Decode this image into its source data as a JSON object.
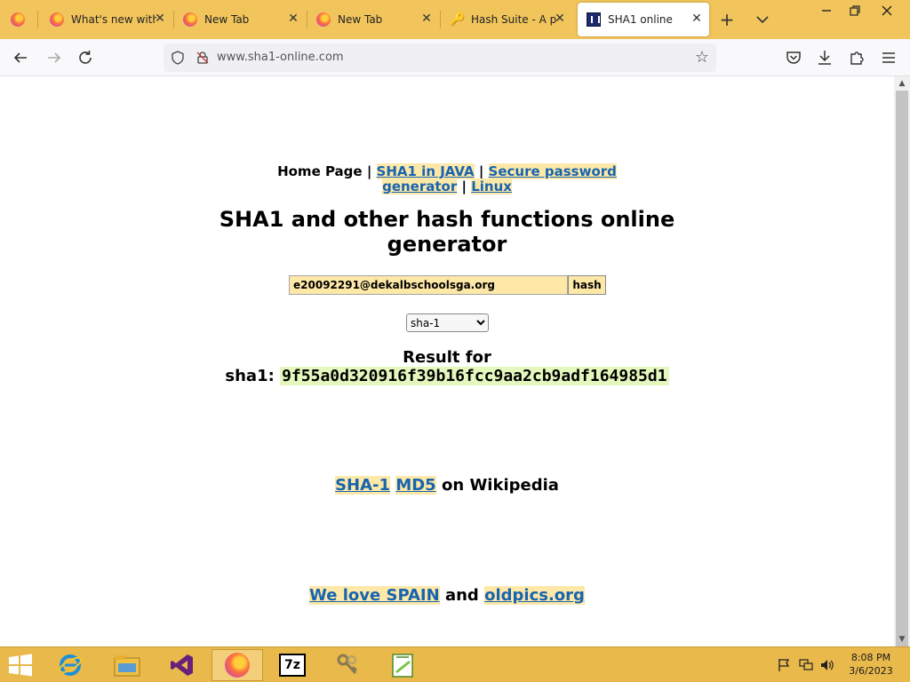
{
  "browser": {
    "tabs": [
      {
        "label": "What's new with F",
        "icon": "firefox-icon",
        "active": false
      },
      {
        "label": "New Tab",
        "icon": "firefox-icon",
        "active": false
      },
      {
        "label": "New Tab",
        "icon": "firefox-icon",
        "active": false
      },
      {
        "label": "Hash Suite - A pr",
        "icon": "key-icon",
        "active": false
      },
      {
        "label": "SHA1 online",
        "icon": "sha1-online-icon",
        "active": true
      }
    ],
    "close_glyph": "✕",
    "new_tab_glyph": "+",
    "url": "www.sha1-online.com"
  },
  "page": {
    "nav": {
      "home": "Home Page",
      "sep": "|",
      "java": "SHA1 in JAVA",
      "secure": "Secure password generator",
      "linux": "Linux"
    },
    "title": "SHA1 and other hash functions online generator",
    "input_value": "e20092291@dekalbschoolsga.org",
    "hash_button": "hash",
    "algorithm": "sha-1",
    "result_label": "Result for",
    "result_algo": "sha1:",
    "result_hash": "9f55a0d320916f39b16fcc9aa2cb9adf164985d1",
    "wiki_sha": "SHA-1",
    "wiki_md5": "MD5",
    "wiki_suffix": "on Wikipedia",
    "love_link": "We love SPAIN",
    "and_text": "and",
    "oldpics_link": "oldpics.org"
  },
  "taskbar": {
    "apps": [
      "internet-explorer-icon",
      "file-explorer-icon",
      "visual-studio-icon",
      "firefox-icon",
      "7zip-icon",
      "hash-suite-icon",
      "notepadpp-icon"
    ],
    "sevenzip_label": "7z",
    "time": "8:08 PM",
    "date": "3/6/2023"
  }
}
